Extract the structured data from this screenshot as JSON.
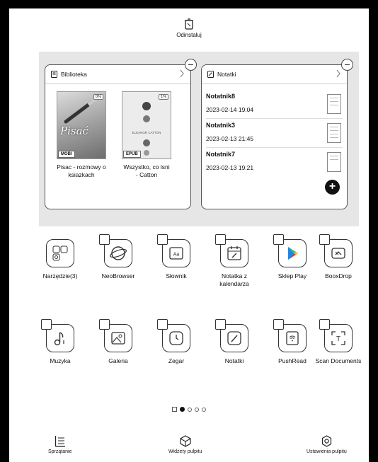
{
  "header": {
    "uninstall_label": "Odinstaluj",
    "icon": "trash-icon"
  },
  "library_widget": {
    "title": "Biblioteka",
    "books": [
      {
        "cover_title": "Pisać",
        "title": "Pisac - rozmowy o ksiazkach",
        "format": "MOBI",
        "progress": "0%"
      },
      {
        "cover_author": "ELEANOR CATTON",
        "title": "Wszystko, co lsni - Catton",
        "format": "EPUB",
        "progress": "1%"
      }
    ]
  },
  "notes_widget": {
    "title": "Notatki",
    "notes": [
      {
        "name": "Notatnik8",
        "date": "2023-02-14 19:04"
      },
      {
        "name": "Notatnik3",
        "date": "2023-02-13 21:45"
      },
      {
        "name": "Notatnik7",
        "date": "2023-02-13 19:21"
      }
    ],
    "add_label": "+"
  },
  "apps": [
    {
      "label": "Narzędzie(3)",
      "icon": "tools-folder-icon"
    },
    {
      "label": "NeoBrowser",
      "icon": "browser-icon"
    },
    {
      "label": "Słownik",
      "icon": "dictionary-icon"
    },
    {
      "label": "Notatka z kalendarza",
      "icon": "calendar-note-icon"
    },
    {
      "label": "Sklep Play",
      "icon": "play-store-icon"
    },
    {
      "label": "BooxDrop",
      "icon": "booxdrop-icon"
    },
    {
      "label": "Muzyka",
      "icon": "music-icon"
    },
    {
      "label": "Galeria",
      "icon": "gallery-icon"
    },
    {
      "label": "Zegar",
      "icon": "clock-icon"
    },
    {
      "label": "Notatki",
      "icon": "notes-icon"
    },
    {
      "label": "PushRead",
      "icon": "pushread-icon"
    },
    {
      "label": "Scan Documents",
      "icon": "scan-icon"
    }
  ],
  "pager": {
    "pages": 4,
    "active_page": 1
  },
  "bottom_bar": {
    "cleanup": "Sprzątanie",
    "widgets": "Widżety pulpitu",
    "settings": "Ustawienia pulpitu"
  }
}
